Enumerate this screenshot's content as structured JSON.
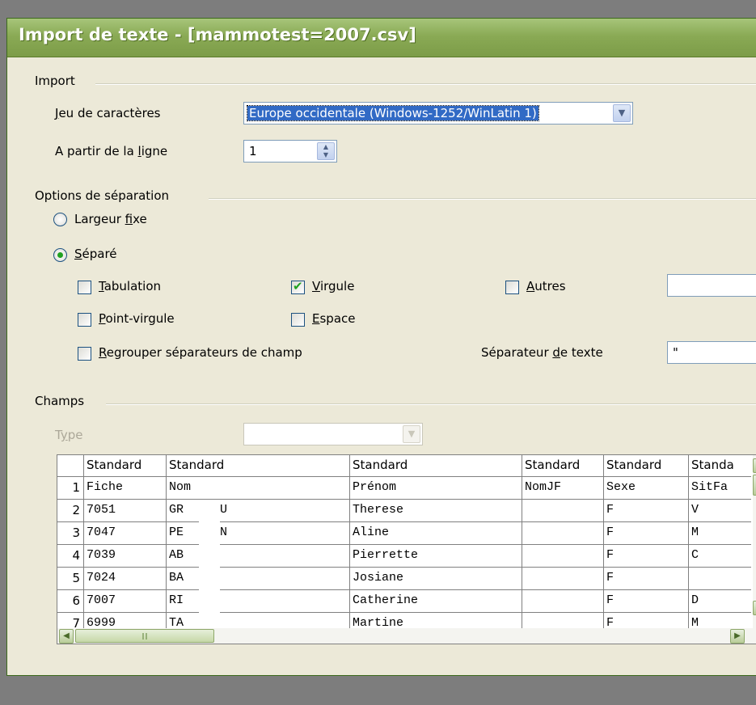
{
  "window": {
    "title": "Import de texte - [mammotest=2007.csv]"
  },
  "import_section": {
    "label": "Import",
    "charset_label": "Jeu de caractères",
    "charset_label_u": "J",
    "charset_label_rest": "eu de caractères",
    "charset_value": "Europe occidentale (Windows-1252/WinLatin 1)",
    "from_line_pre": "A partir de la ",
    "from_line_u": "l",
    "from_line_post": "igne",
    "from_line_value": "1"
  },
  "separation": {
    "label": "Options de séparation",
    "fixed_pre": "Largeur ",
    "fixed_u": "f",
    "fixed_post": "ixe",
    "separated_u": "S",
    "separated_post": "éparé",
    "tab_u": "T",
    "tab_post": "abulation",
    "semicolon_u": "P",
    "semicolon_post": "oint-virgule",
    "comma_u": "V",
    "comma_post": "irgule",
    "space_u": "E",
    "space_post": "space",
    "other_u": "A",
    "other_post": "utres",
    "merge_u": "R",
    "merge_post": "egrouper séparateurs de champ",
    "text_sep_pre": "Séparateur ",
    "text_sep_u": "d",
    "text_sep_post": "e texte",
    "text_sep_value": "\"",
    "checked": {
      "tab": false,
      "semicolon": false,
      "comma": true,
      "space": false,
      "other": false,
      "merge": false
    },
    "mode": "separated"
  },
  "fields": {
    "label": "Champs",
    "type_pre": "T",
    "type_u": "y",
    "type_post": "pe"
  },
  "grid": {
    "headers": [
      "Standard",
      "Standard",
      "Standard",
      "Standard",
      "Standard",
      "Standa"
    ],
    "row_numbers": [
      "1",
      "2",
      "3",
      "4",
      "5",
      "6",
      "7"
    ],
    "rows": [
      [
        "Fiche",
        "Nom",
        "Prénom",
        "NomJF",
        "Sexe",
        "SitFa"
      ],
      [
        "7051",
        "GR   EAU",
        "Therese",
        "",
        "F",
        "V"
      ],
      [
        "7047",
        "PE   HON",
        "Aline",
        "",
        "F",
        "M"
      ],
      [
        "7039",
        "AB    E",
        "Pierrette",
        "",
        "F",
        "C"
      ],
      [
        "7024",
        "BA   TE",
        "Josiane",
        "",
        "F",
        ""
      ],
      [
        "7007",
        "RI   '",
        "Catherine",
        "",
        "F",
        "D"
      ],
      [
        "6999",
        "TA   AT",
        "Martine",
        "",
        "F",
        "M"
      ]
    ]
  }
}
